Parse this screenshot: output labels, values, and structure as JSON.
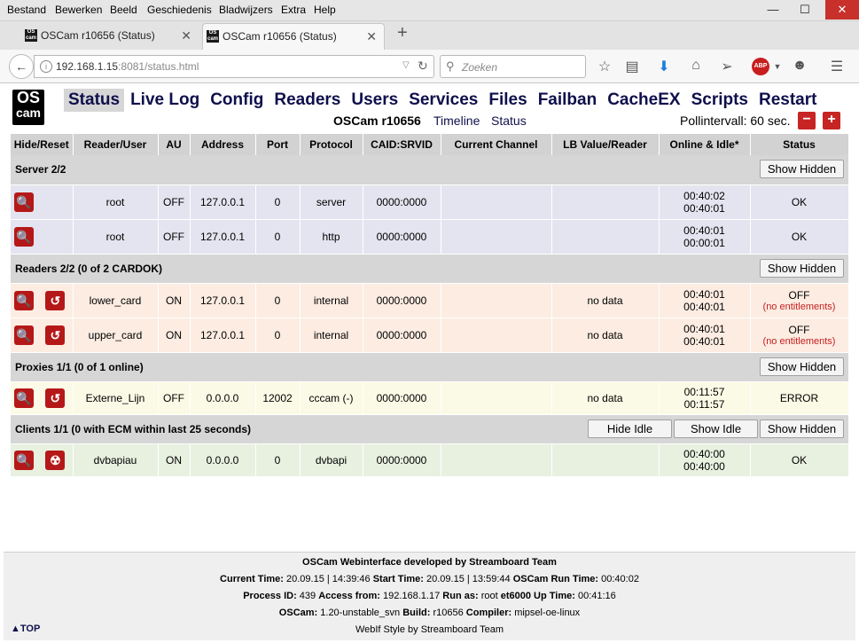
{
  "browser": {
    "menu": [
      "Bestand",
      "Bewerken",
      "Beeld",
      "Geschiedenis",
      "Bladwijzers",
      "Extra",
      "Help"
    ],
    "tabs": [
      {
        "title": "OSCam r10656 (Status)",
        "active": false
      },
      {
        "title": "OSCam r10656 (Status)",
        "active": true
      }
    ],
    "url_host": "192.168.1.15",
    "url_rest": ":8081/status.html",
    "search_placeholder": "Zoeken",
    "window_controls": {
      "minimize": "—",
      "maximize": "☐",
      "close": "✕"
    }
  },
  "logo": {
    "line1": "OS",
    "line2": "cam"
  },
  "menu": [
    "Status",
    "Live Log",
    "Config",
    "Readers",
    "Users",
    "Services",
    "Files",
    "Failban",
    "CacheEX",
    "Scripts",
    "Restart"
  ],
  "subbar": {
    "version": "OSCam r10656",
    "timeline": "Timeline",
    "status": "Status",
    "poll_label": "Pollintervall: 60 sec.",
    "minus": "−",
    "plus": "+"
  },
  "columns": [
    "Hide/Reset",
    "Reader/User",
    "AU",
    "Address",
    "Port",
    "Protocol",
    "CAID:SRVID",
    "Current Channel",
    "LB Value/Reader",
    "Online & Idle*",
    "Status"
  ],
  "groups": {
    "server": {
      "title": "Server 2/2",
      "btn_hidden": "Show Hidden"
    },
    "readers": {
      "title": "Readers 2/2 (0 of 2 CARDOK)",
      "btn_hidden": "Show Hidden"
    },
    "proxies": {
      "title": "Proxies 1/1 (0 of 1 online)",
      "btn_hidden": "Show Hidden"
    },
    "clients": {
      "title": "Clients 1/1 (0 with ECM within last 25 seconds)",
      "btn_hide_idle": "Hide Idle",
      "btn_show_idle": "Show Idle",
      "btn_hidden": "Show Hidden"
    }
  },
  "server_rows": [
    {
      "name": "root",
      "au": "OFF",
      "addr": "127.0.0.1",
      "port": "0",
      "proto": "server",
      "caid": "0000:0000",
      "channel": "",
      "lb": "",
      "online": "00:40:02",
      "idle": "00:40:01",
      "status": "OK"
    },
    {
      "name": "root",
      "au": "OFF",
      "addr": "127.0.0.1",
      "port": "0",
      "proto": "http",
      "caid": "0000:0000",
      "channel": "",
      "lb": "",
      "online": "00:40:01",
      "idle": "00:00:01",
      "status": "OK"
    }
  ],
  "reader_rows": [
    {
      "name": "lower_card",
      "au": "ON",
      "addr": "127.0.0.1",
      "port": "0",
      "proto": "internal",
      "caid": "0000:0000",
      "channel": "",
      "lb": "no data",
      "online": "00:40:01",
      "idle": "00:40:01",
      "status": "OFF",
      "status2": "(no entitlements)"
    },
    {
      "name": "upper_card",
      "au": "ON",
      "addr": "127.0.0.1",
      "port": "0",
      "proto": "internal",
      "caid": "0000:0000",
      "channel": "",
      "lb": "no data",
      "online": "00:40:01",
      "idle": "00:40:01",
      "status": "OFF",
      "status2": "(no entitlements)"
    }
  ],
  "proxy_rows": [
    {
      "name": "Externe_Lijn",
      "au": "OFF",
      "addr": "0.0.0.0",
      "port": "12002",
      "proto": "cccam (-)",
      "caid": "0000:0000",
      "channel": "",
      "lb": "no data",
      "online": "00:11:57",
      "idle": "00:11:57",
      "status": "ERROR"
    }
  ],
  "client_rows": [
    {
      "name": "dvbapiau",
      "au": "ON",
      "addr": "0.0.0.0",
      "port": "0",
      "proto": "dvbapi",
      "caid": "0000:0000",
      "channel": "",
      "lb": "",
      "online": "00:40:00",
      "idle": "00:40:00",
      "status": "OK"
    }
  ],
  "footer": {
    "line1": "OSCam Webinterface developed by Streamboard Team",
    "l2_k1": "Current Time:",
    "l2_v1": "20.09.15 | 14:39:46",
    "l2_k2": "Start Time:",
    "l2_v2": "20.09.15 | 13:59:44",
    "l2_k3": "OSCam Run Time:",
    "l2_v3": "00:40:02",
    "l3_k1": "Process ID:",
    "l3_v1": "439",
    "l3_k2": "Access from:",
    "l3_v2": "192.168.1.17",
    "l3_k3": "Run as:",
    "l3_v3": "root",
    "l3_v3b": "et6000",
    "l3_k4": "Up Time:",
    "l3_v4": "00:41:16",
    "l4_k1": "OSCam:",
    "l4_v1": "1.20-unstable_svn",
    "l4_k2": "Build:",
    "l4_v2": "r10656",
    "l4_k3": "Compiler:",
    "l4_v3": "mipsel-oe-linux",
    "line5": "WebIf Style by Streamboard Team",
    "top": "▲TOP"
  },
  "colors": {
    "accent": "#0f0f4b",
    "danger": "#c72424",
    "server_bg": "#e4e4f0",
    "reader_bg": "#fcece2",
    "proxy_bg": "#fbfae6",
    "client_bg": "#e8f0e0"
  }
}
